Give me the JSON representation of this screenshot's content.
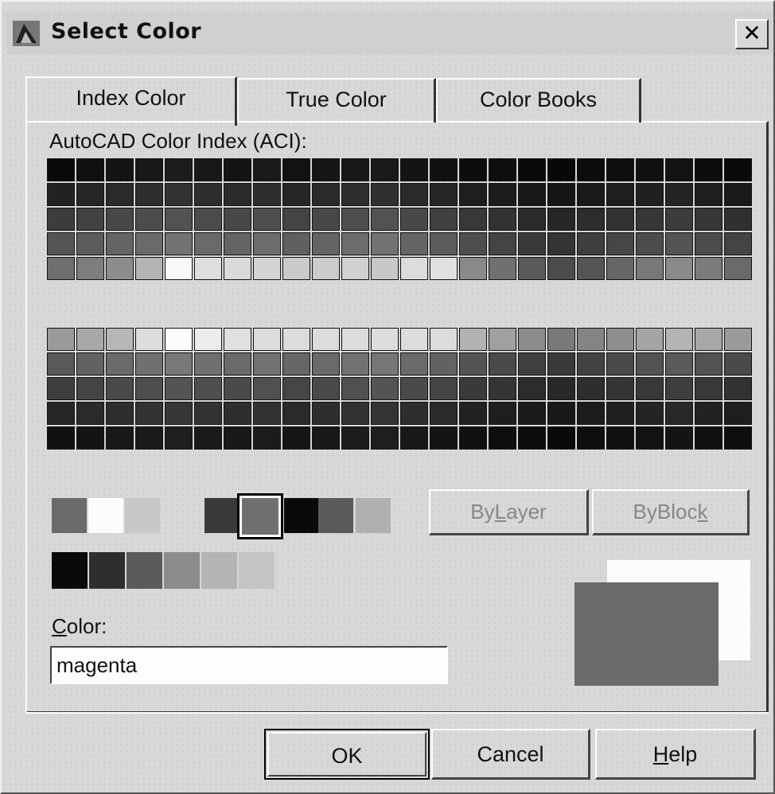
{
  "window": {
    "title": "Select Color",
    "close_glyph": "✕"
  },
  "tabs": [
    {
      "label": "Index Color",
      "active": true
    },
    {
      "label": "True Color",
      "active": false
    },
    {
      "label": "Color Books",
      "active": false
    }
  ],
  "aci": {
    "label": "AutoCAD Color Index (ACI):",
    "rows": [
      [
        "#0a0a0a",
        "#101010",
        "#141414",
        "#181818",
        "#1c1c1c",
        "#181818",
        "#141414",
        "#1a1a1a",
        "#121212",
        "#161616",
        "#181818",
        "#1a1a1a",
        "#141414",
        "#101010",
        "#0c0c0c",
        "#0e0e0e",
        "#0a0a0a",
        "#080808",
        "#0c0c0c",
        "#0e0e0e",
        "#101010",
        "#121212",
        "#0c0c0c",
        "#0a0a0a"
      ],
      [
        "#222",
        "#262626",
        "#2a2a2a",
        "#2e2e2e",
        "#323232",
        "#2e2e2e",
        "#2a2a2a",
        "#2e2e2e",
        "#262626",
        "#2a2a2a",
        "#2e2e2e",
        "#303030",
        "#2a2a2a",
        "#262626",
        "#1e1e1e",
        "#1c1c1c",
        "#181818",
        "#161616",
        "#1a1a1a",
        "#1e1e1e",
        "#202020",
        "#242424",
        "#1e1e1e",
        "#1a1a1a"
      ],
      [
        "#3c3c3c",
        "#424242",
        "#484848",
        "#4c4c4c",
        "#525252",
        "#4c4c4c",
        "#484848",
        "#4e4e4e",
        "#444",
        "#484848",
        "#4e4e4e",
        "#525252",
        "#484848",
        "#404040",
        "#383838",
        "#323232",
        "#2a2a2a",
        "#262626",
        "#2c2c2c",
        "#323232",
        "#363636",
        "#3c3c3c",
        "#363636",
        "#303030"
      ],
      [
        "#555",
        "#5c5c5c",
        "#646464",
        "#6a6a6a",
        "#727272",
        "#6a6a6a",
        "#646464",
        "#6c6c6c",
        "#606060",
        "#646464",
        "#6c6c6c",
        "#727272",
        "#646464",
        "#5c5c5c",
        "#4e4e4e",
        "#444",
        "#3a3a3a",
        "#343434",
        "#3e3e3e",
        "#464646",
        "#4c4c4c",
        "#545454",
        "#4c4c4c",
        "#444"
      ],
      [
        "#6f6f6f",
        "#7d7d7d",
        "#8c8c8c",
        "#b4b4b4",
        "#f8f8f8",
        "#dedede",
        "#dadada",
        "#d4d4d4",
        "#cacaca",
        "#cccccc",
        "#d0d0d0",
        "#c8c8c8",
        "#dcdcdc",
        "#e0e0e0",
        "#8a8a8a",
        "#707070",
        "#5a5a5a",
        "#4c4c4c",
        "#555",
        "#666",
        "#787878",
        "#8a8a8a",
        "#7c7c7c",
        "#6a6a6a"
      ],
      [
        "#9a9a9a",
        "#a8a8a8",
        "#b6b6b6",
        "#dcdcdc",
        "#fcfcfc",
        "#ececec",
        "#e0e0e0",
        "#dcdcdc",
        "#dcdcdc",
        "#dcdcdc",
        "#dcdcdc",
        "#dcdcdc",
        "#dcdcdc",
        "#dcdcdc",
        "#b2b2b2",
        "#a0a0a0",
        "#8c8c8c",
        "#7a7a7a",
        "#848484",
        "#8e8e8e",
        "#a4a4a4",
        "#b4b4b4",
        "#a8a8a8",
        "#9a9a9a"
      ],
      [
        "#595959",
        "#626262",
        "#6a6a6a",
        "#707070",
        "#787878",
        "#707070",
        "#6a6a6a",
        "#727272",
        "#666",
        "#6a6a6a",
        "#727272",
        "#767676",
        "#6a6a6a",
        "#626262",
        "#545454",
        "#4a4a4a",
        "#404040",
        "#3a3a3a",
        "#424242",
        "#4a4a4a",
        "#525252",
        "#5a5a5a",
        "#525252",
        "#4a4a4a"
      ],
      [
        "#3e3e3e",
        "#444",
        "#4a4a4a",
        "#4e4e4e",
        "#545454",
        "#4e4e4e",
        "#4a4a4a",
        "#505050",
        "#464646",
        "#4a4a4a",
        "#505050",
        "#545454",
        "#4a4a4a",
        "#444",
        "#3a3a3a",
        "#343434",
        "#2c2c2c",
        "#282828",
        "#2e2e2e",
        "#343434",
        "#383838",
        "#3e3e3e",
        "#383838",
        "#323232"
      ],
      [
        "#262626",
        "#2a2a2a",
        "#2e2e2e",
        "#323232",
        "#363636",
        "#323232",
        "#2e2e2e",
        "#323232",
        "#2a2a2a",
        "#2e2e2e",
        "#323232",
        "#343434",
        "#2e2e2e",
        "#2a2a2a",
        "#222",
        "#1e1e1e",
        "#1a1a1a",
        "#181818",
        "#1c1c1c",
        "#202020",
        "#242424",
        "#282828",
        "#222",
        "#1e1e1e"
      ],
      [
        "#111",
        "#141414",
        "#181818",
        "#1a1a1a",
        "#1e1e1e",
        "#1a1a1a",
        "#181818",
        "#1c1c1c",
        "#161616",
        "#181818",
        "#1c1c1c",
        "#1e1e1e",
        "#181818",
        "#141414",
        "#101010",
        "#0e0e0e",
        "#0c0c0c",
        "#0a0a0a",
        "#0e0e0e",
        "#101010",
        "#121212",
        "#141414",
        "#101010",
        "#0e0e0e"
      ]
    ]
  },
  "standard_colors": [
    "#6a6a6a",
    "#fcfcfc",
    "#c8c8c8",
    "#3a3a3a",
    "#707070",
    "#0a0a0a",
    "#5a5a5a",
    "#b0b0b0"
  ],
  "gray_colors": [
    "#0a0a0a",
    "#2e2e2e",
    "#5a5a5a",
    "#8c8c8c",
    "#b4b4b4",
    "#c4c4c4"
  ],
  "buttons": {
    "bylayer": {
      "pre": "By",
      "key": "L",
      "post": "ayer"
    },
    "byblock": {
      "pre": "ByBloc",
      "key": "k",
      "post": ""
    },
    "ok": "OK",
    "cancel": "Cancel",
    "help": {
      "key": "H",
      "post": "elp"
    }
  },
  "color_field": {
    "label_key": "C",
    "label_post": "olor:",
    "value": "magenta"
  },
  "preview": {
    "new_color": "#6a6a6a",
    "old_color": "#fcfcfc"
  }
}
